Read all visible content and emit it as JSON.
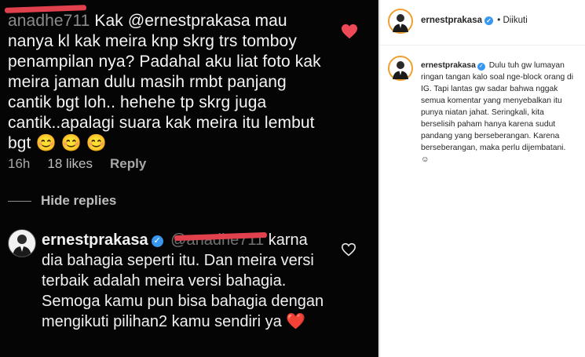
{
  "comment": {
    "username_visible": "anadhe711",
    "text": "Kak @ernestprakasa mau nanya kl kak meira knp skrg trs tomboy penampilan nya? Padahal aku liat foto kak meira jaman dulu masih rmbt panjang cantik bgt loh.. hehehe tp skrg juga cantik..apalagi suara kak meira itu lembut bgt",
    "emojis": "😊 😊 😊",
    "time": "16h",
    "likes": "18 likes",
    "reply_label": "Reply",
    "liked": true
  },
  "hide_replies_label": "Hide replies",
  "reply": {
    "username": "ernestprakasa",
    "mention": "@anadhe711",
    "text": "karna dia bahagia seperti itu. Dan meira versi terbaik adalah meira versi bahagia. Semoga kamu pun bisa bahagia dengan mengikuti pilihan2 kamu sendiri ya",
    "emoji": "❤️"
  },
  "post": {
    "username": "ernestprakasa",
    "verified_icon": "verified-badge-icon",
    "separator": "•",
    "follow_status": "Diikuti",
    "caption": "Dulu tuh gw lumayan ringan tangan kalo soal nge-block orang di IG. Tapi lantas gw sadar bahwa nggak semua komentar yang menyebalkan itu punya niatan jahat. Seringkali, kita berselisih paham hanya karena sudut pandang yang berseberangan. Karena berseberangan, maka perlu dijembatani.",
    "caption_emoji": "☺"
  },
  "colors": {
    "dark_bg": "#050505",
    "redaction": "#e0414d",
    "heart": "#ed4956",
    "verified": "#3897f0",
    "story_ring": "#f0a030"
  }
}
